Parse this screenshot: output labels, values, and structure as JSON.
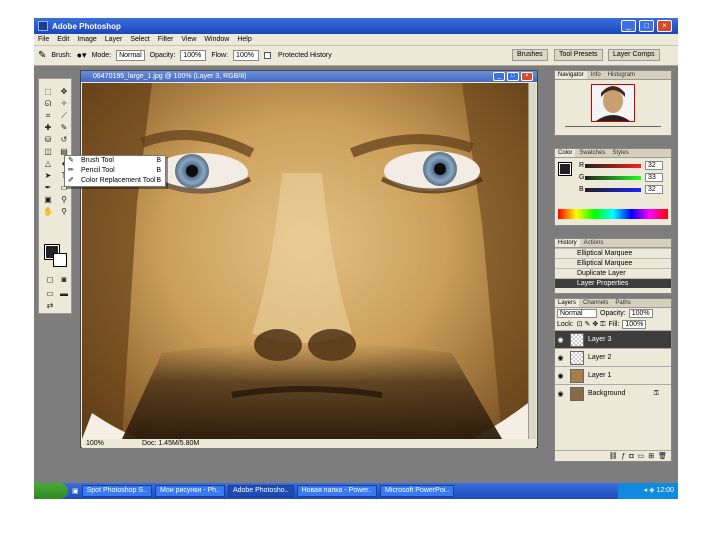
{
  "window": {
    "title": "Adobe Photoshop"
  },
  "menu": [
    "File",
    "Edit",
    "Image",
    "Layer",
    "Select",
    "Filter",
    "View",
    "Window",
    "Help"
  ],
  "options": {
    "brush_label": "Brush:",
    "mode_label": "Mode:",
    "mode_value": "Normal",
    "opacity_label": "Opacity:",
    "opacity_value": "100%",
    "flow_label": "Flow:",
    "flow_value": "100%",
    "airbrush_label": "Protected History",
    "tabs": [
      "Brushes",
      "Tool Presets",
      "Layer Comps"
    ]
  },
  "document": {
    "title": "06470195_large_1.jpg @ 100% (Layer 3, RGB/8)",
    "zoom": "100%",
    "doc_info": "Doc: 1.45M/5.80M"
  },
  "flyout": {
    "items": [
      {
        "label": "Brush Tool",
        "key": "B"
      },
      {
        "label": "Pencil Tool",
        "key": "B"
      },
      {
        "label": "Color Replacement Tool",
        "key": "B"
      }
    ]
  },
  "panels": {
    "navigator_tabs": [
      "Navigator",
      "Info",
      "Histogram"
    ],
    "color_tabs": [
      "Color",
      "Swatches",
      "Styles"
    ],
    "color_values": {
      "r": "32",
      "g": "33",
      "b": "32"
    },
    "color_labels": {
      "r": "R",
      "g": "G",
      "b": "B"
    },
    "history_tabs": [
      "History",
      "Actions"
    ],
    "history_items": [
      "Elliptical Marquee",
      "Elliptical Marquee",
      "Duplicate Layer",
      "Layer Properties"
    ],
    "layers_tabs": [
      "Layers",
      "Channels",
      "Paths"
    ],
    "blend_mode": "Normal",
    "opacity_label": "Opacity:",
    "opacity_value": "100%",
    "lock_label": "Lock:",
    "fill_label": "Fill:",
    "fill_value": "100%",
    "layers": [
      "Layer 3",
      "Layer 2",
      "Layer 1",
      "Background"
    ]
  },
  "taskbar": {
    "items": [
      "Spot Photoshop S..",
      "Мои рисунки - Ph..",
      "Adobe Photosho..",
      "Новая папка - Power..",
      "Microsoft PowerPoi.."
    ],
    "clock": "12:00"
  }
}
